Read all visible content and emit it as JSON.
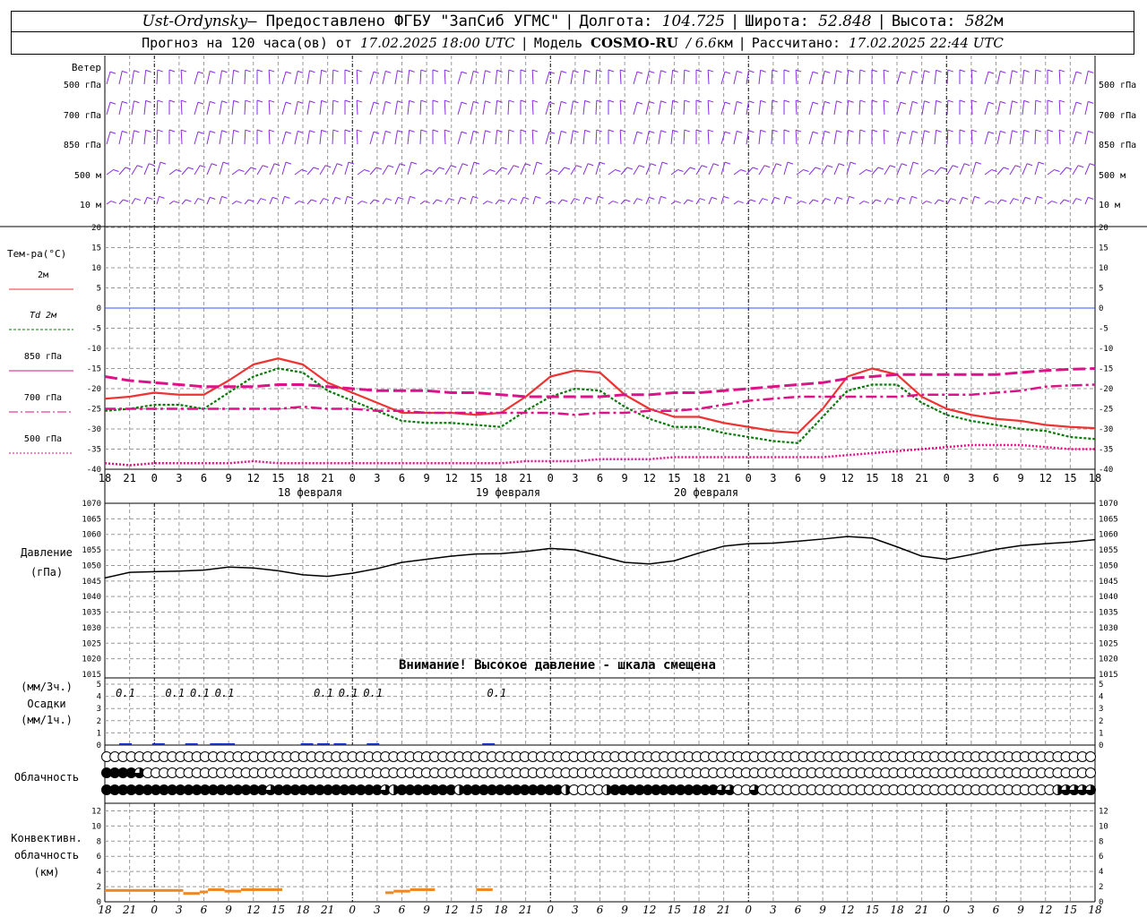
{
  "header": {
    "station": "Ust-Ordynsky",
    "provider": " — Предоставлено ФГБУ \"ЗапСиб УГМС\"",
    "lon_label": "Долгота:",
    "lon_value": "104.725",
    "lat_label": "Широта:",
    "lat_value": "52.848",
    "alt_label": "Высота:",
    "alt_value": "582",
    "alt_unit": "м",
    "forecast_label": "Прогноз на 120 часа(ов) от",
    "forecast_start": "17.02.2025 18:00 UTC",
    "model_label": "Модель",
    "model_name": "COSMO-RU",
    "model_res": "/ 6.6",
    "model_res_unit": "км",
    "calc_label": "Рассчитано:",
    "calc_time": "17.02.2025 22:44 UTC"
  },
  "colors": {
    "wind": "#8a2be2",
    "t2m": "#ee3333",
    "td2m": "#0a7a0a",
    "t850": "#dd1188",
    "zero_line": "#3355ff",
    "pressure": "#000000",
    "precip": "#1133cc",
    "convective": "#ee8822",
    "grid": "#999999"
  },
  "labels": {
    "wind_title": "Ветер",
    "wind_levels": [
      "500 гПа",
      "700 гПа",
      "850 гПа",
      "500 м",
      "10 м"
    ],
    "temp_title": "Тем-ра(°C)",
    "temp_legend": [
      {
        "text": "2м",
        "color": "#ee3333",
        "dash": ""
      },
      {
        "text": "Td 2м",
        "color": "#0a7a0a",
        "dash": "3,2"
      },
      {
        "text": "850 гПа",
        "color": "#dd1188",
        "dash": ""
      },
      {
        "text": "700 гПа",
        "color": "#dd1188",
        "dash": "10,3,2,3"
      },
      {
        "text": "500 гПа",
        "color": "#dd1188",
        "dash": "2,2"
      }
    ],
    "pressure_title_1": "Давление",
    "pressure_title_2": "(гПа)",
    "pressure_warning": "Внимание! Высокое давление - шкала смещена",
    "precip_title_1": "(мм/3ч.)",
    "precip_title_2": "Осадки",
    "precip_title_3": "(мм/1ч.)",
    "cloud_title": "Облачность",
    "conv_title_1": "Конвективн.",
    "conv_title_2": "облачность",
    "conv_title_3": "(км)"
  },
  "chart_data": {
    "type": "line",
    "x_hours": [
      0,
      3,
      6,
      9,
      12,
      15,
      18,
      21,
      24,
      27,
      30,
      33,
      36,
      39,
      42,
      45,
      48,
      51,
      54,
      57,
      60,
      63,
      66,
      69,
      72,
      75,
      78,
      81,
      84,
      87,
      90,
      93,
      96,
      99,
      102,
      105,
      108,
      111,
      114,
      117,
      120
    ],
    "x_tick_labels": [
      "18",
      "21",
      "0",
      "3",
      "6",
      "9",
      "12",
      "15",
      "18",
      "21",
      "0",
      "3",
      "6",
      "9",
      "12",
      "15",
      "18",
      "21",
      "0",
      "3",
      "6",
      "9",
      "12",
      "15",
      "18",
      "21",
      "0",
      "3",
      "6",
      "9",
      "12",
      "15",
      "18",
      "21",
      "0",
      "3",
      "6",
      "9",
      "12",
      "15",
      "18",
      "21",
      "0"
    ],
    "day_labels": [
      {
        "hour": 24,
        "text": "18 февраля"
      },
      {
        "hour": 48,
        "text": "19 февраля"
      },
      {
        "hour": 72,
        "text": "20 февраля"
      }
    ],
    "temperature": {
      "ylim": [
        -40,
        20
      ],
      "yticks": [
        20,
        15,
        10,
        5,
        0,
        -5,
        -10,
        -15,
        -20,
        -25,
        -30,
        -35,
        -40
      ],
      "series": [
        {
          "name": "2м",
          "values": [
            -22.5,
            -22,
            -21,
            -21.5,
            -21.5,
            -18,
            -14,
            -12.5,
            -14,
            -18.5,
            -21,
            -23.5,
            -26,
            -26,
            -26,
            -26.5,
            -26,
            -22,
            -17,
            -15.5,
            -16,
            -21.5,
            -25,
            -27,
            -27,
            -28.5,
            -29.5,
            -30.5,
            -31,
            -25,
            -17,
            -15,
            -16.5,
            -22,
            -25,
            -26.5,
            -27.5,
            -28,
            -29,
            -29.5,
            -29.8
          ]
        },
        {
          "name": "Td 2м",
          "values": [
            -25.5,
            -25,
            -24,
            -24,
            -25,
            -21,
            -17,
            -15,
            -16,
            -20.5,
            -23,
            -25.5,
            -28,
            -28.5,
            -28.5,
            -29,
            -29.5,
            -25.5,
            -22,
            -20,
            -20.5,
            -24.5,
            -27.5,
            -29.5,
            -29.5,
            -31,
            -32,
            -33,
            -33.5,
            -27,
            -20.5,
            -19,
            -19,
            -23.5,
            -26.5,
            -28,
            -29,
            -30,
            -30.5,
            -32,
            -32.5
          ]
        },
        {
          "name": "850 гПа",
          "values": [
            -17,
            -18,
            -18.5,
            -19,
            -19.5,
            -19.5,
            -19.5,
            -19,
            -19,
            -19.5,
            -20,
            -20.5,
            -20.5,
            -20.5,
            -21,
            -21,
            -21.5,
            -22,
            -22,
            -22,
            -22,
            -21.5,
            -21.5,
            -21,
            -21,
            -20.5,
            -20,
            -19.5,
            -19,
            -18.5,
            -17.5,
            -17,
            -16.5,
            -16.5,
            -16.5,
            -16.5,
            -16.5,
            -16,
            -15.5,
            -15.2,
            -15
          ]
        },
        {
          "name": "700 гПа",
          "values": [
            -25,
            -25,
            -25,
            -25,
            -25,
            -25,
            -25,
            -25,
            -24.5,
            -25,
            -25,
            -25.5,
            -25.5,
            -26,
            -26,
            -26,
            -26,
            -26,
            -26,
            -26.5,
            -26,
            -26,
            -25.5,
            -25.5,
            -25,
            -24,
            -23,
            -22.5,
            -22,
            -22,
            -22,
            -22,
            -22,
            -21.5,
            -21.5,
            -21.5,
            -21,
            -20.5,
            -19.5,
            -19.2,
            -19
          ]
        },
        {
          "name": "500 гПа",
          "values": [
            -38.5,
            -39,
            -38.5,
            -38.5,
            -38.5,
            -38.5,
            -38,
            -38.5,
            -38.5,
            -38.5,
            -38.5,
            -38.5,
            -38.5,
            -38.5,
            -38.5,
            -38.5,
            -38.5,
            -38,
            -38,
            -38,
            -37.5,
            -37.5,
            -37.5,
            -37,
            -37,
            -37,
            -37,
            -37,
            -37,
            -37,
            -36.5,
            -36,
            -35.5,
            -35,
            -34.5,
            -34,
            -34,
            -34,
            -34.5,
            -35,
            -35
          ]
        }
      ]
    },
    "pressure": {
      "ylim": [
        1015,
        1070
      ],
      "yticks": [
        1070,
        1065,
        1060,
        1055,
        1050,
        1045,
        1040,
        1035,
        1030,
        1025,
        1020,
        1015
      ],
      "values": [
        1046,
        1047.8,
        1048,
        1048.2,
        1048.5,
        1049.5,
        1049.2,
        1048.3,
        1047,
        1046.5,
        1047.5,
        1049,
        1051,
        1052,
        1053,
        1053.7,
        1053.8,
        1054.5,
        1055.5,
        1055,
        1053,
        1051,
        1050.5,
        1051.5,
        1054,
        1056.2,
        1057,
        1057.2,
        1057.8,
        1058.5,
        1059.3,
        1058.8,
        1056,
        1053,
        1052,
        1053.5,
        1055.2,
        1056.4,
        1057,
        1057.5,
        1058.3
      ]
    },
    "precipitation": {
      "ylim": [
        0,
        5
      ],
      "yticks": [
        5,
        4,
        3,
        2,
        1,
        0
      ],
      "annotations": [
        {
          "hour": 2.5,
          "text": "0.1"
        },
        {
          "hour": 8.5,
          "text": "0.1"
        },
        {
          "hour": 11.5,
          "text": "0.1"
        },
        {
          "hour": 14.5,
          "text": "0.1"
        },
        {
          "hour": 26.5,
          "text": "0.1"
        },
        {
          "hour": 29.5,
          "text": "0.1"
        },
        {
          "hour": 32.5,
          "text": "0.1"
        },
        {
          "hour": 47.5,
          "text": "0.1"
        }
      ],
      "bars": [
        {
          "hour": 2.5,
          "value": 0.05
        },
        {
          "hour": 6.5,
          "value": 0.05
        },
        {
          "hour": 10.5,
          "value": 0.08
        },
        {
          "hour": 13.5,
          "value": 0.15
        },
        {
          "hour": 15,
          "value": 0.08
        },
        {
          "hour": 24.5,
          "value": 0.05
        },
        {
          "hour": 26.5,
          "value": 0.05
        },
        {
          "hour": 28.5,
          "value": 0.05
        },
        {
          "hour": 32.5,
          "value": 0.05
        },
        {
          "hour": 46.5,
          "value": 0.05
        }
      ]
    },
    "convective_cloud": {
      "ylim": [
        0,
        13
      ],
      "yticks": [
        12,
        10,
        8,
        6,
        4,
        2,
        0
      ],
      "segments": [
        {
          "from": 0,
          "to": 9.5,
          "value": 1.5
        },
        {
          "from": 9.5,
          "to": 11.5,
          "value": 1.1
        },
        {
          "from": 11.5,
          "to": 12.5,
          "value": 1.3
        },
        {
          "from": 12.5,
          "to": 14.5,
          "value": 1.6
        },
        {
          "from": 14.5,
          "to": 16.5,
          "value": 1.4
        },
        {
          "from": 16.5,
          "to": 21.5,
          "value": 1.6
        },
        {
          "from": 34,
          "to": 35,
          "value": 1.2
        },
        {
          "from": 35,
          "to": 37,
          "value": 1.4
        },
        {
          "from": 37,
          "to": 40,
          "value": 1.6
        },
        {
          "from": 45,
          "to": 47,
          "value": 1.6
        }
      ]
    },
    "clouds": {
      "rows": [
        {
          "name": "upper",
          "cover": [
            0,
            0,
            0,
            0,
            0,
            0,
            0,
            0,
            0,
            0,
            0,
            0,
            0,
            0,
            0,
            0,
            0,
            0,
            0,
            0,
            0,
            0,
            0,
            0,
            0,
            0,
            0,
            0,
            0,
            0,
            0,
            0,
            0,
            0,
            0,
            0,
            0,
            0,
            0,
            0,
            0,
            0,
            0,
            0,
            0,
            0,
            0,
            0,
            0,
            0,
            0,
            0,
            0,
            0,
            0,
            0,
            0,
            0,
            0,
            0,
            0,
            0,
            0,
            0,
            0,
            0,
            0,
            0,
            0,
            0,
            0,
            0,
            0,
            0,
            0,
            0,
            0,
            0,
            0,
            0,
            0,
            0,
            0,
            0,
            0,
            0,
            0,
            0,
            0,
            0,
            0,
            0,
            0,
            0,
            0,
            0,
            0,
            0,
            0,
            0,
            0,
            0,
            0,
            0,
            0,
            0,
            0,
            0,
            0,
            0,
            0,
            0,
            0,
            0,
            0,
            0,
            0,
            0,
            0,
            0,
            0
          ]
        },
        {
          "name": "middle",
          "cover": [
            1,
            1,
            1,
            1,
            0.75,
            0,
            0,
            0,
            0,
            0,
            0,
            0,
            0,
            0,
            0,
            0,
            0,
            0,
            0,
            0,
            0,
            0,
            0,
            0,
            0,
            0,
            0,
            0,
            0,
            0,
            0,
            0,
            0,
            0,
            0,
            0,
            0,
            0,
            0,
            0,
            0,
            0,
            0,
            0,
            0,
            0,
            0,
            0,
            0,
            0,
            0,
            0,
            0,
            0,
            0,
            0,
            0,
            0,
            0,
            0,
            0,
            0,
            0,
            0,
            0,
            0,
            0,
            0,
            0,
            0,
            0,
            0,
            0,
            0,
            0,
            0,
            0,
            0,
            0,
            0,
            0,
            0,
            0,
            0,
            0,
            0,
            0,
            0,
            0,
            0,
            0,
            0,
            0,
            0,
            0,
            0,
            0,
            0,
            0,
            0,
            0,
            0,
            0,
            0,
            0,
            0,
            0,
            0,
            0,
            0,
            0,
            0,
            0,
            0,
            0,
            0,
            0,
            0,
            0,
            0,
            0
          ]
        },
        {
          "name": "lower",
          "cover": [
            1,
            1,
            1,
            1,
            1,
            1,
            1,
            1,
            1,
            1,
            1,
            1,
            1,
            1,
            1,
            1,
            1,
            1,
            1,
            1,
            0.75,
            1,
            1,
            1,
            1,
            1,
            1,
            1,
            1,
            1,
            1,
            1,
            1,
            1,
            0.75,
            0.5,
            1,
            1,
            1,
            1,
            1,
            1,
            1,
            0.5,
            1,
            1,
            1,
            1,
            1,
            1,
            1,
            1,
            1,
            1,
            1,
            1,
            0.5,
            0,
            0,
            0,
            0,
            0.5,
            1,
            1,
            1,
            1,
            1,
            1,
            1,
            1,
            1,
            1,
            1,
            1,
            1,
            0.75,
            0.75,
            0,
            0,
            0.75,
            0,
            0,
            0,
            0,
            0,
            0,
            0,
            0,
            0,
            0,
            0,
            0,
            0,
            0,
            0,
            0,
            0,
            0,
            0,
            0,
            0,
            0,
            0,
            0,
            0,
            0,
            0,
            0,
            0,
            0,
            0,
            0,
            0,
            0,
            0,
            0,
            0.5,
            0.75,
            0.75,
            0.75,
            0.75
          ]
        }
      ]
    },
    "wind_barbs_rows": 5
  }
}
